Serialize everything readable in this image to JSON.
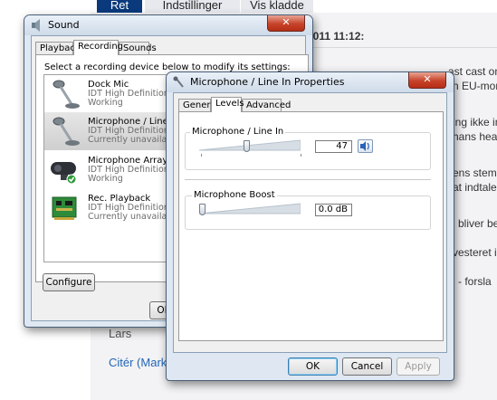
{
  "webpage": {
    "tabs": [
      {
        "label": "Ret"
      },
      {
        "label": "Indstillinger"
      },
      {
        "label": "Vis kladde"
      }
    ],
    "post_date": "2011 11:12:",
    "text_fragments": [
      "ast cast om",
      "n EU-mor",
      "ing ikke inve",
      "hans head",
      "ens stemm",
      "at indtale",
      "l bliver bed",
      "vesteret i",
      "i - forsla"
    ],
    "signature": "Lars",
    "quote_link": "Citér (Marke"
  },
  "sound_dialog": {
    "title": "Sound",
    "close_glyph": "✕",
    "tabs": [
      "Playback",
      "Recording",
      "Sounds"
    ],
    "active_tab": "Recording",
    "instruction": "Select a recording device below to modify its settings:",
    "devices": [
      {
        "name": "Dock Mic",
        "driver": "IDT High Definition Au",
        "status": "Working",
        "icon": "microphone-icon"
      },
      {
        "name": "Microphone / Line In",
        "driver": "IDT High Definition Au",
        "status": "Currently unavailable",
        "icon": "microphone-icon"
      },
      {
        "name": "Microphone Array",
        "driver": "IDT High Definition Au",
        "status": "Working",
        "icon": "webcam-icon"
      },
      {
        "name": "Rec. Playback",
        "driver": "IDT High Definition Au",
        "status": "Currently unavailable",
        "icon": "sound-card-icon"
      }
    ],
    "configure_label": "Configure",
    "ok_label": "OK"
  },
  "properties_dialog": {
    "title": "Microphone / Line In Properties",
    "close_glyph": "✕",
    "tabs": [
      "General",
      "Levels",
      "Advanced"
    ],
    "active_tab": "Levels",
    "mic_group_label": "Microphone / Line In",
    "mic_level": 47,
    "boost_group_label": "Microphone Boost",
    "boost_value": "0.0 dB",
    "boost_level": 0,
    "ok_label": "OK",
    "cancel_label": "Cancel",
    "apply_label": "Apply"
  },
  "colors": {
    "web_tab_active": "#0a3a7c",
    "close_button": "#c7432a",
    "link": "#2266b8"
  }
}
